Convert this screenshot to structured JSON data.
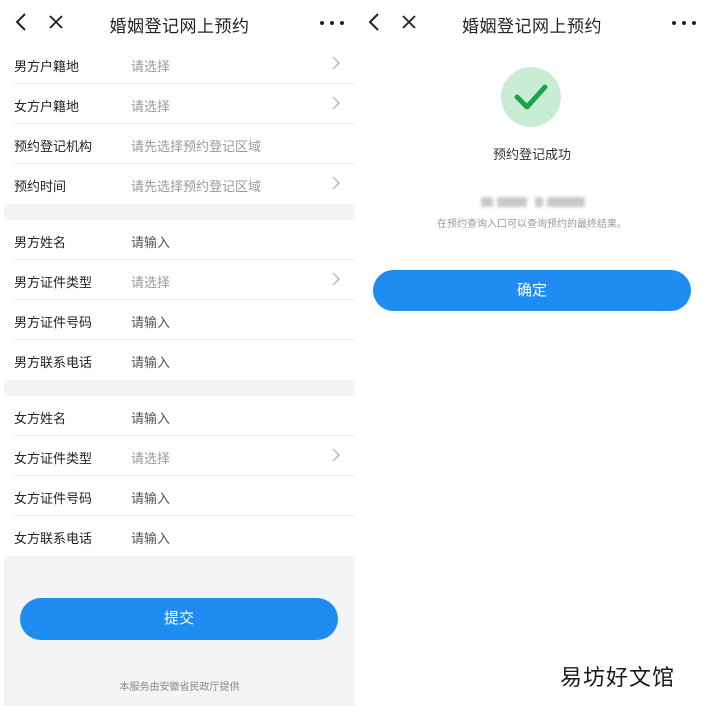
{
  "left": {
    "title": "婚姻登记网上预约",
    "back_icon": "‹",
    "close_icon": "✕",
    "groups": [
      [
        {
          "label": "男方户籍地",
          "value": "请选择",
          "chevron": true
        },
        {
          "label": "女方户籍地",
          "value": "请选择",
          "chevron": true
        },
        {
          "label": "预约登记机构",
          "value": "请先选择预约登记区域",
          "chevron": false
        },
        {
          "label": "预约时间",
          "value": "请先选择预约登记区域",
          "chevron": true
        }
      ],
      [
        {
          "label": "男方姓名",
          "value": "请输入",
          "chevron": false
        },
        {
          "label": "男方证件类型",
          "value": "请选择",
          "chevron": true
        },
        {
          "label": "男方证件号码",
          "value": "请输入",
          "chevron": false
        },
        {
          "label": "男方联系电话",
          "value": "请输入",
          "chevron": false
        }
      ],
      [
        {
          "label": "女方姓名",
          "value": "请输入",
          "chevron": false
        },
        {
          "label": "女方证件类型",
          "value": "请选择",
          "chevron": true
        },
        {
          "label": "女方证件号码",
          "value": "请输入",
          "chevron": false
        },
        {
          "label": "女方联系电话",
          "value": "请输入",
          "chevron": false
        }
      ]
    ],
    "submit_label": "提交",
    "footnote": "本服务由安徽省民政厅提供"
  },
  "right": {
    "title": "婚姻登记网上预约",
    "success_title": "预约登记成功",
    "hint": "在预约查询入口可以查询预约的最终结果。",
    "confirm_label": "确定"
  },
  "watermark": "易坊好文馆",
  "colors": {
    "accent": "#1e8cf0",
    "success_bg": "#c9ecd5",
    "success_check": "#1aa34a",
    "page_bg": "#f3f4f6"
  },
  "icons": {
    "back": "chevron-left-icon",
    "close": "close-icon",
    "more": "more-dots-icon",
    "row_arrow": "chevron-right-icon",
    "success": "checkmark-icon"
  }
}
